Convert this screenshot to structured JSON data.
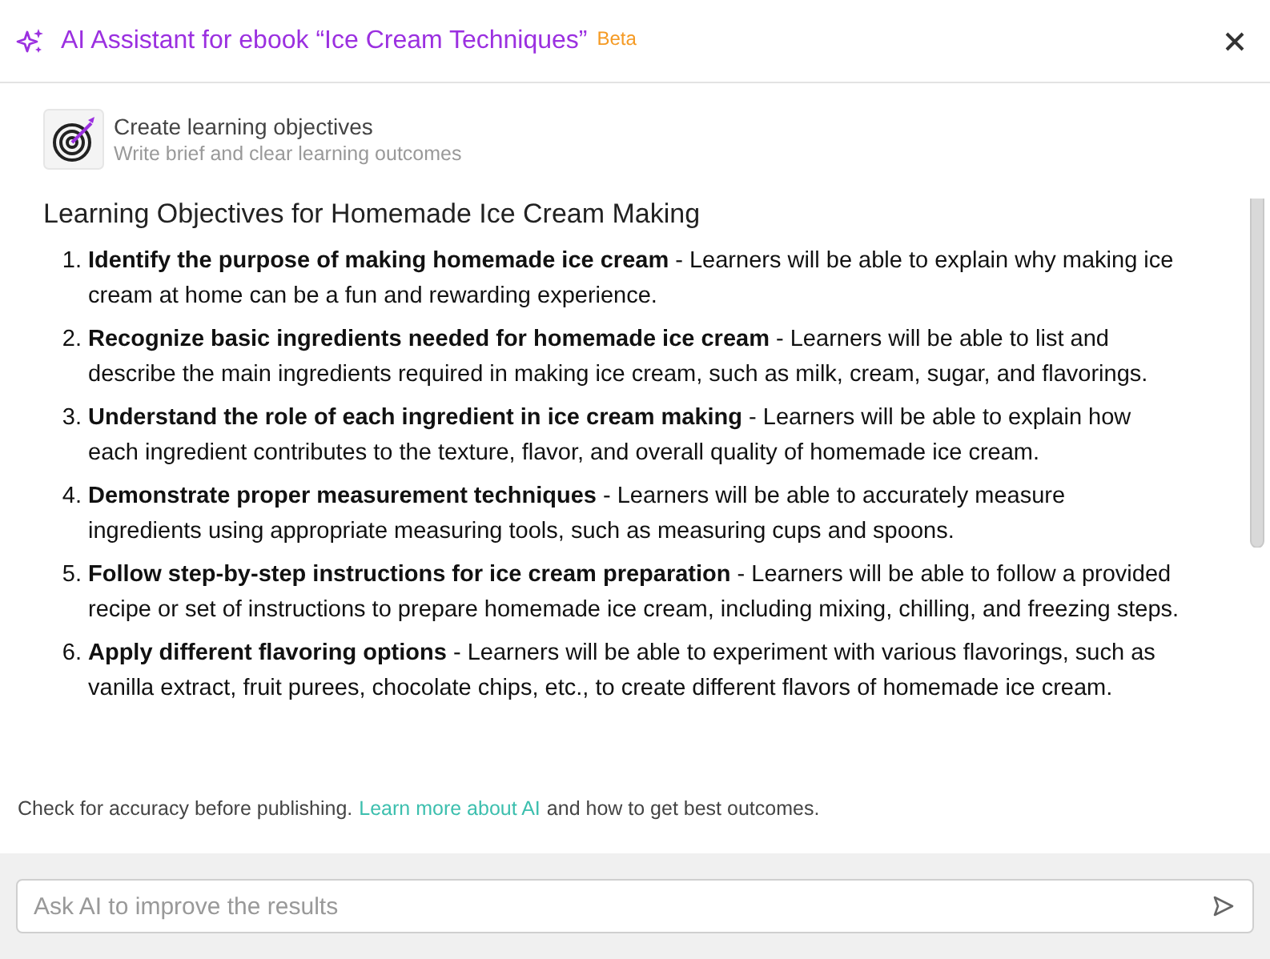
{
  "header": {
    "title": "AI Assistant for ebook “Ice Cream Techniques”",
    "badge": "Beta"
  },
  "task": {
    "title": "Create learning objectives",
    "subtitle": "Write brief and clear learning outcomes"
  },
  "result": {
    "heading": "Learning Objectives for Homemade Ice Cream Making",
    "items": [
      {
        "number": "1.",
        "text": "**Identify the purpose of making homemade ice cream** - Learners will be able to explain why making ice cream at home can be a fun and rewarding experience."
      },
      {
        "number": "2.",
        "text": "**Recognize basic ingredients needed for homemade ice cream** - Learners will be able to list and describe the main ingredients required in making ice cream, such as milk, cream, sugar, and flavorings."
      },
      {
        "number": "3.",
        "text": "**Understand the role of each ingredient in ice cream making** - Learners will be able to explain how each ingredient contributes to the texture, flavor, and overall quality of homemade ice cream."
      },
      {
        "number": "4.",
        "text": "**Demonstrate proper measurement techniques** - Learners will be able to accurately measure ingredients using appropriate measuring tools, such as measuring cups and spoons."
      },
      {
        "number": "5.",
        "text": "**Follow step-by-step instructions for ice cream preparation** - Learners will be able to follow a provided recipe or set of instructions to prepare homemade ice cream, including mixing, chilling, and freezing steps."
      },
      {
        "number": "6.",
        "text": "**Apply different flavoring options** - Learners will be able to experiment with various flavorings, such as vanilla extract, fruit purees, chocolate chips, etc., to create different flavors of homemade ice cream."
      }
    ]
  },
  "notice": {
    "before": "Check for accuracy before publishing.",
    "link": "Learn more about AI",
    "after": "and how to get best outcomes."
  },
  "prompt": {
    "placeholder": "Ask AI to improve the results"
  }
}
